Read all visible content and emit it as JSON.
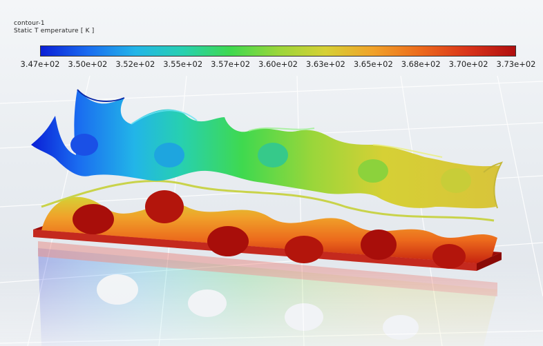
{
  "legend": {
    "title": "contour-1",
    "quantity": "Static T emperature [ K ]",
    "ticks": [
      "3.47e+02",
      "3.50e+02",
      "3.52e+02",
      "3.55e+02",
      "3.57e+02",
      "3.60e+02",
      "3.63e+02",
      "3.65e+02",
      "3.68e+02",
      "3.70e+02",
      "3.73e+02"
    ],
    "colormap": [
      "#0a1fd6",
      "#1a6cf0",
      "#22b5e8",
      "#27d0b0",
      "#3fd94f",
      "#9ad63a",
      "#d6d035",
      "#f0a22a",
      "#ec6a1c",
      "#d9341a",
      "#b00f0f"
    ]
  },
  "colors": {
    "hot": "#a80e0a",
    "cold": "#1233d8",
    "background": "#eef1f4",
    "grid": "#ffffff"
  }
}
